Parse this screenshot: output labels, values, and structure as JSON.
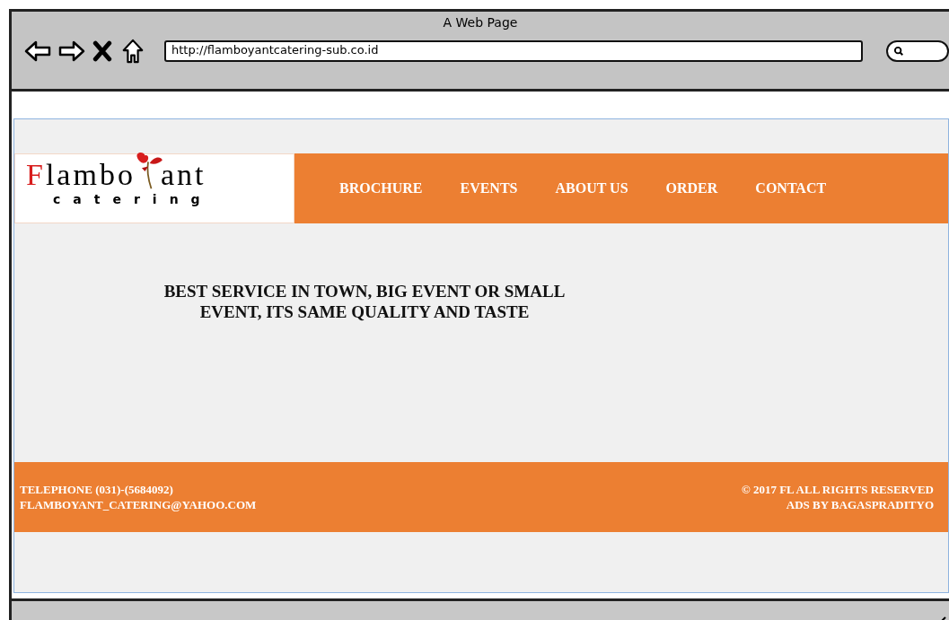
{
  "window": {
    "title": "A Web Page",
    "url": "http://flamboyantcatering-sub.co.id"
  },
  "logo": {
    "name_start": "Flambo",
    "name_end": "ant",
    "tagline": "catering"
  },
  "nav": [
    {
      "label": "BROCHURE"
    },
    {
      "label": "EVENTS"
    },
    {
      "label": "ABOUT US"
    },
    {
      "label": "ORDER"
    },
    {
      "label": "CONTACT"
    }
  ],
  "headline": "BEST SERVICE IN TOWN, BIG EVENT OR SMALL EVENT, ITS SAME QUALITY AND TASTE",
  "footer": {
    "left": [
      "TELEPHONE (031)-(5684092)",
      "FLAMBOYANT_CATERING@YAHOO.COM"
    ],
    "right": [
      "© 2017 FL ALL RIGHTS RESERVED",
      "ADS BY BAGASPRADITYO"
    ]
  }
}
